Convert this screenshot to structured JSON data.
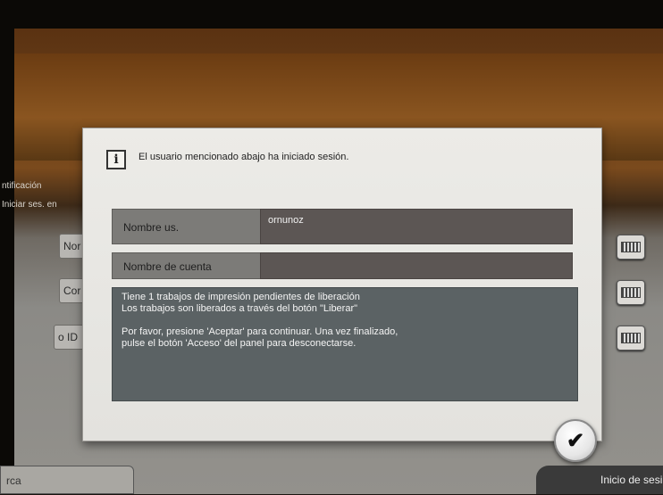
{
  "background": {
    "left_labels": [
      "ntificación",
      "Iniciar ses. en"
    ],
    "fields": [
      "Nor",
      "Cor",
      "o ID"
    ],
    "left_button": "rca",
    "right_button": "Inicio de sesi"
  },
  "dialog": {
    "icon": "info-icon",
    "message": "El usuario mencionado abajo ha iniciado sesión.",
    "user_name_label": "Nombre us.",
    "user_name_value": "ornunoz",
    "account_name_label": "Nombre de cuenta",
    "account_name_value": "",
    "notice_lines": [
      "Tiene 1 trabajos de impresión pendientes de liberación",
      "Los trabajos son liberados a través del botón \"Liberar\"",
      "Por favor, presione 'Aceptar' para continuar. Una vez finalizado,",
      "pulse el botón 'Acceso' del panel para desconectarse."
    ],
    "ok_icon": "checkmark-icon",
    "ok_glyph": "✔"
  },
  "colors": {
    "dialog_bg": "#e3e2de",
    "label_bg": "#7c7b78",
    "value_bg": "#5c5654",
    "notice_bg": "#5b6264"
  }
}
